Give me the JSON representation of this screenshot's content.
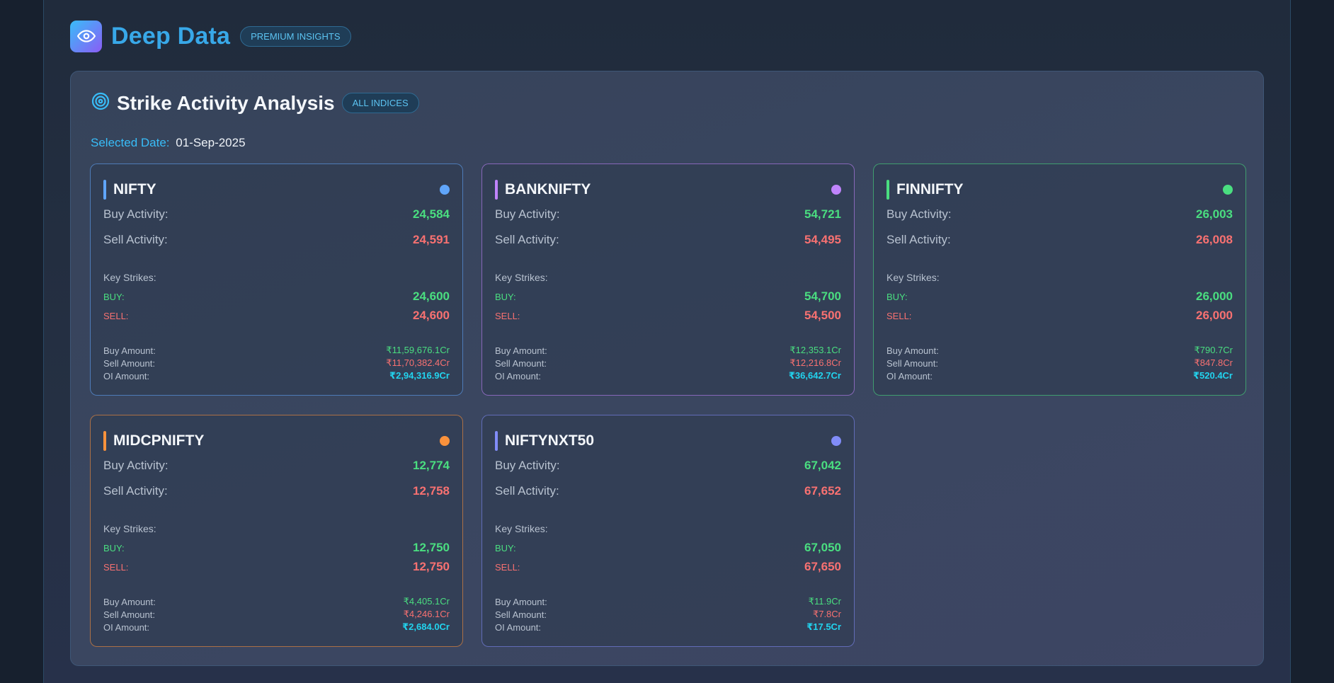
{
  "header": {
    "brand": "Deep Data",
    "badge": "PREMIUM INSIGHTS",
    "logo_icon": "eye-icon"
  },
  "panel": {
    "title": "Strike Activity Analysis",
    "title_icon": "target-icon",
    "badge": "ALL INDICES",
    "date_label": "Selected Date:",
    "date_value": "01-Sep-2025"
  },
  "labels": {
    "buy_activity": "Buy Activity:",
    "sell_activity": "Sell Activity:",
    "key_strikes": "Key Strikes:",
    "buy": "BUY:",
    "sell": "SELL:",
    "buy_amount": "Buy Amount:",
    "sell_amount": "Sell Amount:",
    "oi_amount": "OI Amount:"
  },
  "cards": [
    {
      "name": "NIFTY",
      "color": "#60a5fa",
      "buy_activity": "24,584",
      "sell_activity": "24,591",
      "buy_strike": "24,600",
      "sell_strike": "24,600",
      "buy_amount": "₹11,59,676.1Cr",
      "sell_amount": "₹11,70,382.4Cr",
      "oi_amount": "₹2,94,316.9Cr"
    },
    {
      "name": "BANKNIFTY",
      "color": "#c084fc",
      "buy_activity": "54,721",
      "sell_activity": "54,495",
      "buy_strike": "54,700",
      "sell_strike": "54,500",
      "buy_amount": "₹12,353.1Cr",
      "sell_amount": "₹12,216.8Cr",
      "oi_amount": "₹36,642.7Cr"
    },
    {
      "name": "FINNIFTY",
      "color": "#4ade80",
      "buy_activity": "26,003",
      "sell_activity": "26,008",
      "buy_strike": "26,000",
      "sell_strike": "26,000",
      "buy_amount": "₹790.7Cr",
      "sell_amount": "₹847.8Cr",
      "oi_amount": "₹520.4Cr"
    },
    {
      "name": "MIDCPNIFTY",
      "color": "#fb923c",
      "buy_activity": "12,774",
      "sell_activity": "12,758",
      "buy_strike": "12,750",
      "sell_strike": "12,750",
      "buy_amount": "₹4,405.1Cr",
      "sell_amount": "₹4,246.1Cr",
      "oi_amount": "₹2,684.0Cr"
    },
    {
      "name": "NIFTYNXT50",
      "color": "#818cf8",
      "buy_activity": "67,042",
      "sell_activity": "67,652",
      "buy_strike": "67,050",
      "sell_strike": "67,650",
      "buy_amount": "₹11.9Cr",
      "sell_amount": "₹7.8Cr",
      "oi_amount": "₹17.5Cr"
    }
  ]
}
